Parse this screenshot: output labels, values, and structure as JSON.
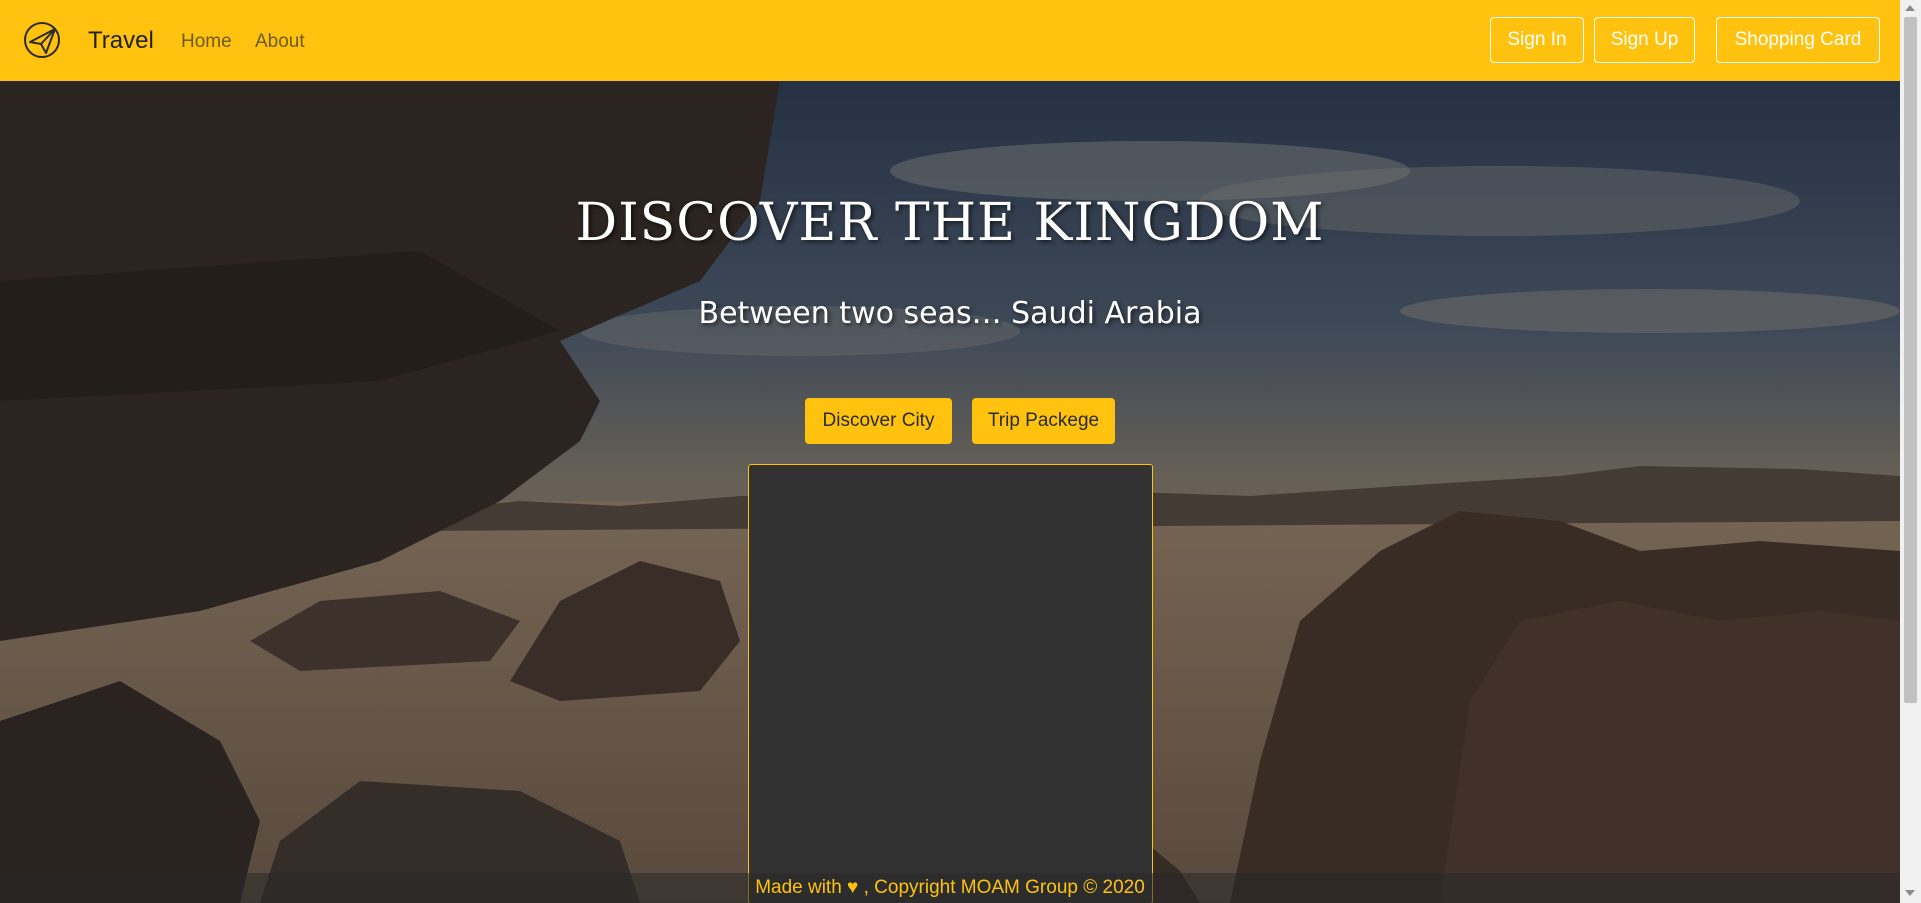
{
  "nav": {
    "brand": "Travel",
    "links": [
      "Home",
      "About"
    ],
    "buttons": [
      "Sign In",
      "Sign Up",
      "Shopping Card"
    ],
    "logo_icon": "paper-plane-icon"
  },
  "hero": {
    "title": "DISCOVER THE KINGDOM",
    "subtitle": "Between two seas… Saudi Arabia",
    "buttons": [
      "Discover City",
      "Trip Packege"
    ]
  },
  "footer": {
    "text": "Made with ♥ , Copyright MOAM Group © 2020"
  },
  "colors": {
    "accent": "#fec20f",
    "panel": "#323232",
    "text_light": "#ffffff"
  }
}
